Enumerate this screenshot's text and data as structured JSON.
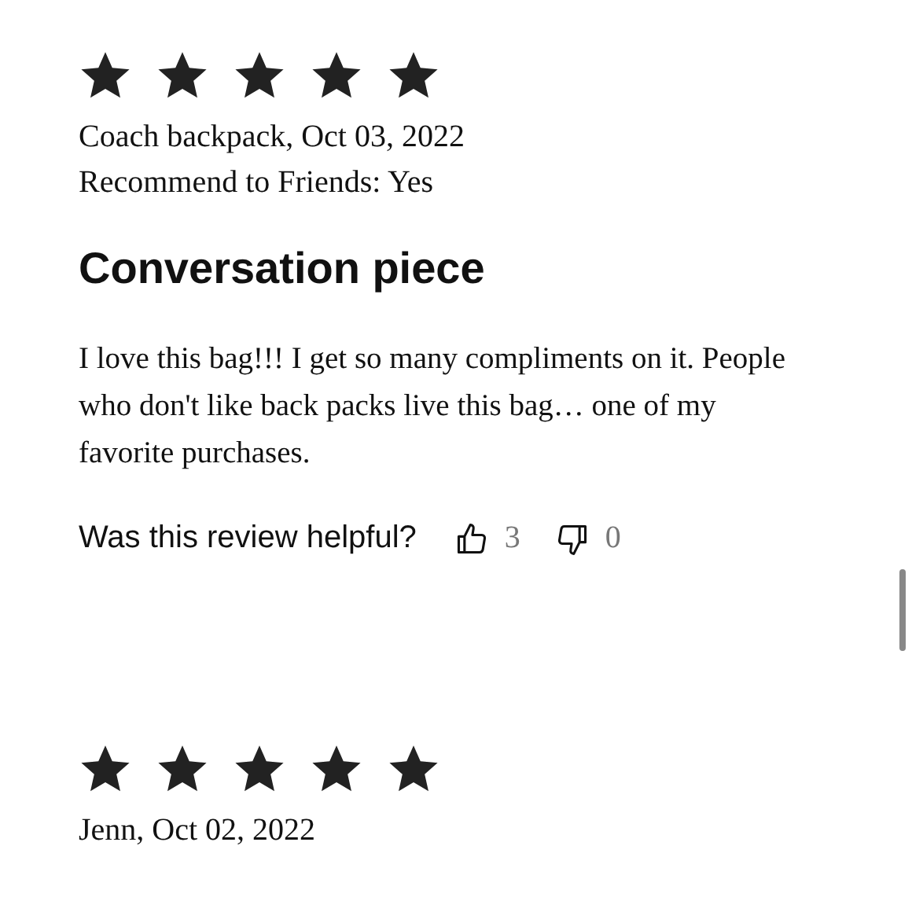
{
  "reviews": [
    {
      "stars": 5,
      "meta": [
        "Coach backpack, Oct 03, 2022",
        "Recommend to Friends: Yes"
      ],
      "title": "Conversation piece",
      "body": "I love this bag!!! I get so many compliments on it. People who don't like back packs live this bag… one of my favorite purchases.",
      "helpful": {
        "question": "Was this review helpful?",
        "up": "3",
        "down": "0"
      }
    },
    {
      "stars": 5,
      "meta": [
        "Jenn, Oct 02, 2022"
      ]
    }
  ]
}
